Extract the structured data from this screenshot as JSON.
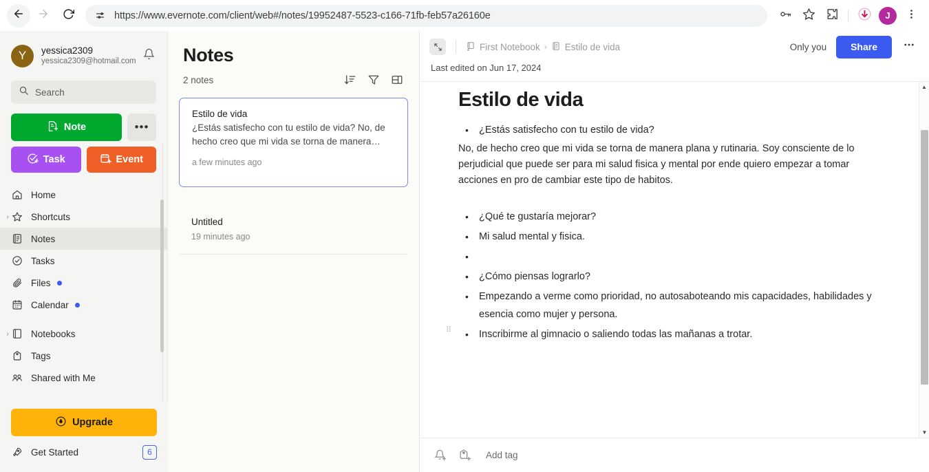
{
  "browser": {
    "back_icon": "back-arrow-icon",
    "forward_icon": "forward-arrow-icon",
    "reload_icon": "reload-icon",
    "site_settings_icon": "tune-sliders-icon",
    "url": "https://www.evernote.com/client/web#/notes/19952487-5523-c166-71fb-feb57a26160e",
    "password_icon": "key-icon",
    "bookmark_icon": "star-icon",
    "extensions_icon": "puzzle-piece-icon",
    "download_icon": "download-arrow-icon",
    "profile_initial": "J",
    "menu_icon": "three-dot-menu-icon"
  },
  "sidebar": {
    "account": {
      "avatar_initial": "Y",
      "name": "yessica2309",
      "email": "yessica2309@hotmail.com",
      "bell_icon": "notification-bell-icon"
    },
    "search": {
      "placeholder": "Search",
      "icon": "search-icon"
    },
    "buttons": {
      "note": "Note",
      "note_icon": "new-note-icon",
      "more": "•••",
      "task": "Task",
      "task_icon": "new-task-icon",
      "event": "Event",
      "event_icon": "new-event-icon"
    },
    "nav": [
      {
        "label": "Home",
        "icon": "home-icon",
        "caret": false,
        "dot": false,
        "active": false
      },
      {
        "label": "Shortcuts",
        "icon": "star-outline-icon",
        "caret": true,
        "dot": false,
        "active": false
      },
      {
        "label": "Notes",
        "icon": "note-icon",
        "caret": false,
        "dot": false,
        "active": true
      },
      {
        "label": "Tasks",
        "icon": "check-circle-icon",
        "caret": false,
        "dot": false,
        "active": false
      },
      {
        "label": "Files",
        "icon": "paperclip-icon",
        "caret": false,
        "dot": true,
        "active": false
      },
      {
        "label": "Calendar",
        "icon": "calendar-icon",
        "caret": false,
        "dot": true,
        "active": false
      },
      {
        "label": "Notebooks",
        "icon": "notebook-icon",
        "caret": true,
        "dot": false,
        "active": false
      },
      {
        "label": "Tags",
        "icon": "tag-icon",
        "caret": false,
        "dot": false,
        "active": false
      },
      {
        "label": "Shared with Me",
        "icon": "shared-people-icon",
        "caret": false,
        "dot": false,
        "active": false
      }
    ],
    "upgrade": {
      "label": "Upgrade",
      "icon": "upgrade-badge-icon"
    },
    "get_started": {
      "label": "Get Started",
      "icon": "rocket-icon",
      "badge": "6"
    }
  },
  "notelist": {
    "title": "Notes",
    "count": "2 notes",
    "tools": [
      {
        "name": "sort-icon",
        "glyph": "sort"
      },
      {
        "name": "filter-icon",
        "glyph": "filter"
      },
      {
        "name": "view-layout-icon",
        "glyph": "layout"
      }
    ],
    "notes": [
      {
        "title": "Estilo de vida",
        "snippet": "¿Estás satisfecho con tu estilo de vida? No, de hecho creo que mi vida se torna de manera…",
        "time": "a few minutes ago",
        "selected": true
      },
      {
        "title": "Untitled",
        "snippet": "",
        "time": "19 minutes ago",
        "selected": false
      }
    ]
  },
  "editor": {
    "expand_icon": "expand-arrows-icon",
    "breadcrumb": {
      "notebook": "First Notebook",
      "notebook_icon": "notebook-star-icon",
      "separator": "›",
      "note": "Estilo de vida",
      "note_icon": "note-page-icon"
    },
    "only_you": "Only you",
    "share_label": "Share",
    "more_icon": "three-dot-menu-icon",
    "last_edited": "Last edited on Jun 17, 2024",
    "doc_title": "Estilo de vida",
    "content": [
      {
        "type": "bullet",
        "text": "¿Estás satisfecho con tu estilo de vida?"
      },
      {
        "type": "para",
        "text": "No, de hecho creo que mi vida se torna de manera plana y rutinaria. Soy consciente de lo perjudicial que puede ser para mi salud fisica y mental por ende quiero empezar a tomar acciones en pro de cambiar este tipo de habitos."
      },
      {
        "type": "bullet",
        "text": "¿Qué te gustaría mejorar?"
      },
      {
        "type": "bullet",
        "text": "Mi salud mental y fisica."
      },
      {
        "type": "bullet",
        "text": ""
      },
      {
        "type": "bullet",
        "text": "¿Cómo piensas lograrlo?"
      },
      {
        "type": "bullet",
        "text": "Empezando a verme como prioridad, no autosaboteando mis capacidades, habilidades y esencia como mujer y persona."
      },
      {
        "type": "bullet",
        "text": "Inscribirme al gimnacio o saliendo todas las mañanas a trotar.",
        "handle": true
      }
    ],
    "footer": {
      "reminder_icon": "add-reminder-bell-icon",
      "tag_icon": "add-tag-icon",
      "add_tag": "Add tag"
    }
  },
  "colors": {
    "note_green": "#00a82d",
    "task_purple": "#a651f0",
    "event_orange": "#ef5f28",
    "upgrade_amber": "#ffb30a",
    "share_blue": "#3b5bf0",
    "selected_border": "#7b87e8",
    "badge_blue": "#3b5bf0"
  }
}
